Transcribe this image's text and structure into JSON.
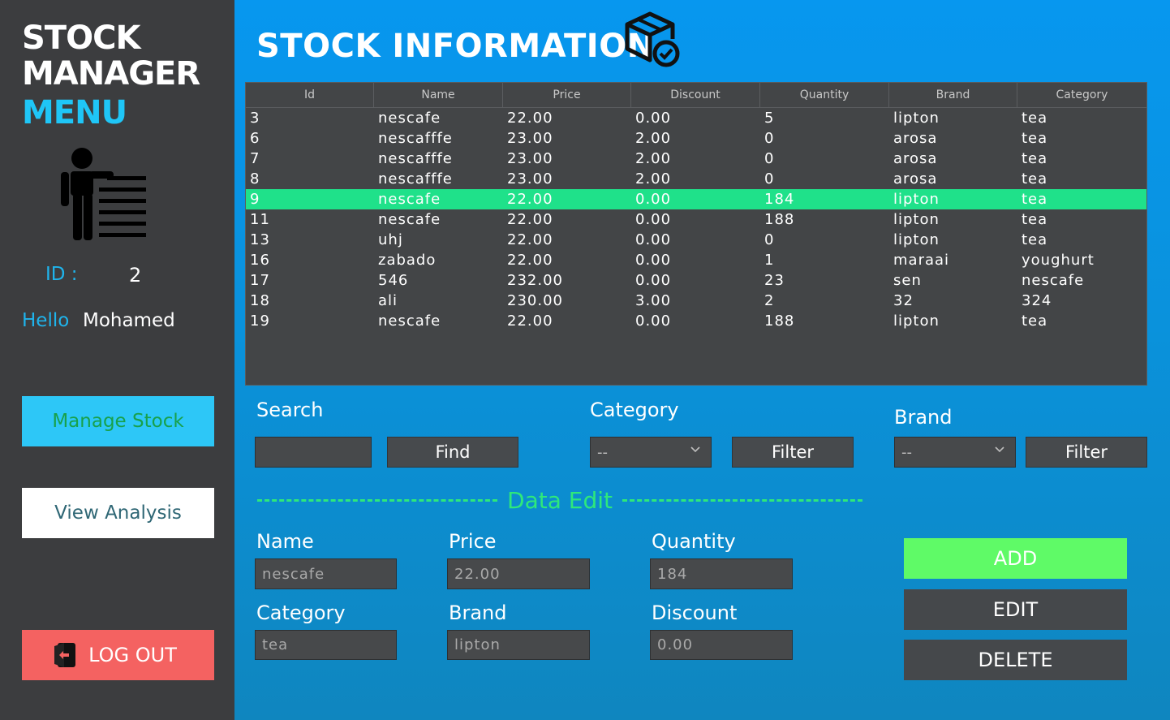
{
  "sidebar": {
    "brand_line1": "STOCK",
    "brand_line2": "MANAGER",
    "brand_line3": "MENU",
    "id_label": "ID :",
    "id_value": "2",
    "hello_label": "Hello",
    "user_name": "Mohamed",
    "manage_stock": "Manage Stock",
    "view_analysis": "View Analysis",
    "logout": "LOG OUT"
  },
  "main": {
    "title": "STOCK INFORMATION"
  },
  "grid": {
    "columns": [
      "Id",
      "Name",
      "Price",
      "Discount",
      "Quantity",
      "Brand",
      "Category"
    ],
    "rows": [
      [
        "3",
        "nescafe",
        "22.00",
        "0.00",
        "5",
        "lipton",
        "tea"
      ],
      [
        "6",
        "nescafffe",
        "23.00",
        "2.00",
        "0",
        "arosa",
        "tea"
      ],
      [
        "7",
        "nescafffe",
        "23.00",
        "2.00",
        "0",
        "arosa",
        "tea"
      ],
      [
        "8",
        "nescafffe",
        "23.00",
        "2.00",
        "0",
        "arosa",
        "tea"
      ],
      [
        "9",
        "nescafe",
        "22.00",
        "0.00",
        "184",
        "lipton",
        "tea"
      ],
      [
        "11",
        "nescafe",
        "22.00",
        "0.00",
        "188",
        "lipton",
        "tea"
      ],
      [
        "13",
        "uhj",
        "22.00",
        "0.00",
        "0",
        "lipton",
        "tea"
      ],
      [
        "16",
        "zabado",
        "22.00",
        "0.00",
        "1",
        "maraai",
        "youghurt"
      ],
      [
        "17",
        "546",
        "232.00",
        "0.00",
        "23",
        "sen",
        "nescafe"
      ],
      [
        "18",
        "ali",
        "230.00",
        "3.00",
        "2",
        "32",
        "324"
      ],
      [
        "19",
        "nescafe",
        "22.00",
        "0.00",
        "188",
        "lipton",
        "tea"
      ]
    ],
    "selected_row_index": 4,
    "selected_color": "#1fe18a"
  },
  "search": {
    "search_label": "Search",
    "search_value": "",
    "find_button": "Find",
    "category_label": "Category",
    "category_selected": "--",
    "category_filter_button": "Filter",
    "brand_label": "Brand",
    "brand_selected": "--",
    "brand_filter_button": "Filter"
  },
  "edit": {
    "section_title": "Data Edit",
    "name_label": "Name",
    "name_value": "nescafe",
    "price_label": "Price",
    "price_value": "22.00",
    "quantity_label": "Quantity",
    "quantity_value": "184",
    "category_label": "Category",
    "category_value": "tea",
    "brand_label": "Brand",
    "brand_value": "lipton",
    "discount_label": "Discount",
    "discount_value": "0.00",
    "add_button": "ADD",
    "edit_button": "EDIT",
    "delete_button": "DELETE"
  },
  "colors": {
    "sidebar_bg": "#3c3d3f",
    "accent_cyan": "#1fc6f7",
    "add_green": "#5ffa67",
    "logout_red": "#f46261",
    "data_edit_green": "#2ee87b"
  },
  "icons": {
    "menu": "person-list-icon",
    "title": "box-check-icon",
    "logout": "door-exit-icon"
  }
}
